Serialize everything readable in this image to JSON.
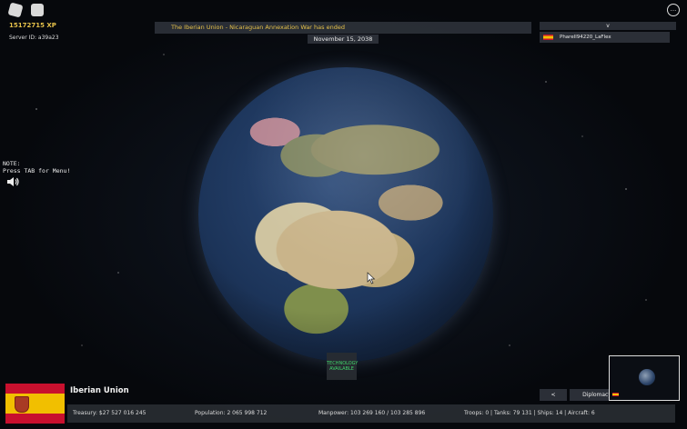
{
  "hud": {
    "xp": "15172715 XP",
    "server_id": "Server ID: a39a23"
  },
  "notification": {
    "message": "The Iberian Union - Nicaraguan Annexation War has ended",
    "date": "November 15, 2038"
  },
  "players_panel": {
    "toggle_label": "v",
    "players": [
      {
        "name": "Pharell94220_LaFlex"
      }
    ]
  },
  "note": {
    "line1": "NOTE:",
    "line2": "Press TAB for Menu!"
  },
  "menu_button": {
    "label": "..."
  },
  "technology_button": {
    "line1": "TECHNOLOGY",
    "line2": "AVAILABLE"
  },
  "country": {
    "name": "Iberian Union"
  },
  "stats": {
    "treasury": "Treasury:  $27 527 016 245",
    "population": "Population: 2 065 998 712",
    "manpower": "Manpower:  103 269 160  /  103 285 896",
    "military": "Troops: 0  |  Tanks: 79 131  |  Ships: 14  |  Aircraft: 6"
  },
  "nav": {
    "back_label": "<",
    "diplomacy_label": "Diplomacy"
  },
  "colors": {
    "accent_gold": "#e5c14a",
    "tech_green": "#3fd36a",
    "panel": "#2d323a"
  }
}
